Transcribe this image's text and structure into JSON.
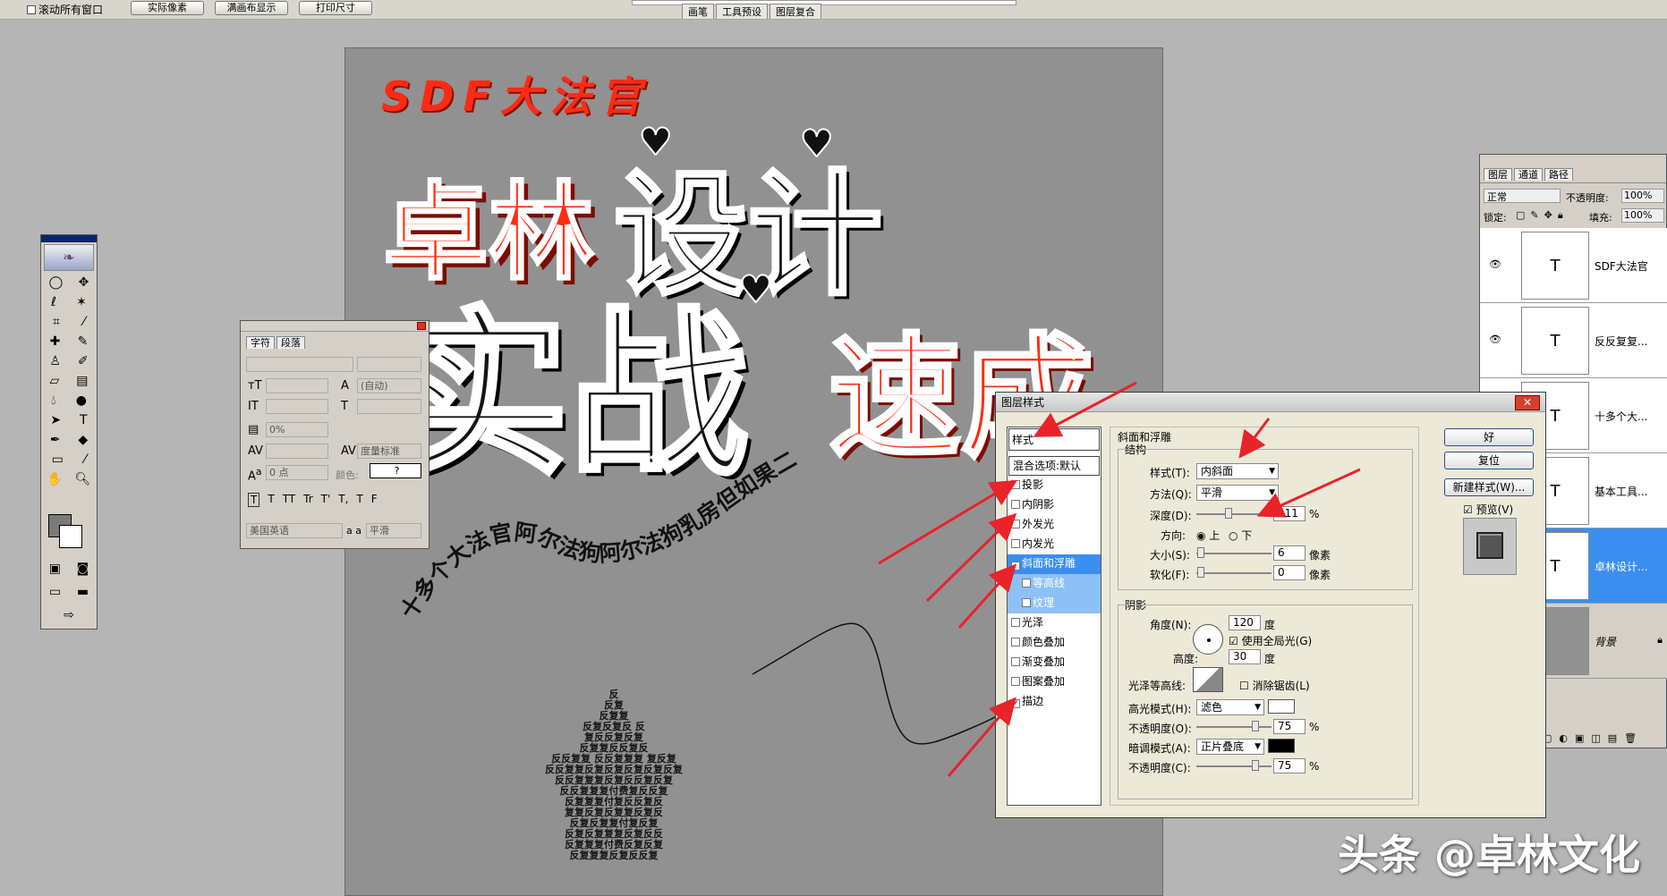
{
  "options_bar": {
    "scroll_all": "滚动所有窗口",
    "actual_pixels": "实际像素",
    "fit_screen": "满画布显示",
    "print_size": "打印尺寸",
    "tabs": [
      "画笔",
      "工具预设",
      "图层复合"
    ]
  },
  "canvas": {
    "sdf": "SDF大法官",
    "zhuolin": "卓林",
    "sheji": "设计",
    "shizhan": "实战",
    "sucheng": "速成",
    "curve_text": "十多个大法官阿尔法狗阿尔法狗乳房但如果二",
    "pyramid_rows": [
      "反",
      "反复",
      "反复复",
      "反复反复反 反",
      "复反反复反复",
      "反复复反反复反",
      "反反复复 反反复复复 复反复",
      "反反复复反复反复反复反复反复",
      "反反复复复反复反反复反复",
      "反反复复复付费复反反复",
      "反复复复付复反反复反",
      "复复反复反复复反复反",
      "反复反复复付复反复",
      "反复反复复复反复反反",
      "反复复复付费反复反复",
      "反复复复反复反反复"
    ]
  },
  "character_panel": {
    "tabs": [
      "字符",
      "段落"
    ],
    "leading": "(自动)",
    "tracking": "0%",
    "kerning_type": "度量标准",
    "baseline": "0 点",
    "color_label": "颜色:",
    "color_value": "?",
    "language": "美国英语",
    "aa_label": "a a",
    "antialias": "平滑",
    "style_buttons": [
      "T",
      "T",
      "TT",
      "Tr",
      "T'",
      "T,",
      "T",
      "F"
    ]
  },
  "layer_style": {
    "title": "图层样式",
    "close": "✕",
    "left_header": "样式",
    "blend_default": "混合选项:默认",
    "items": [
      {
        "label": "投影",
        "checked": false
      },
      {
        "label": "内阴影",
        "checked": false
      },
      {
        "label": "外发光",
        "checked": false
      },
      {
        "label": "内发光",
        "checked": false
      },
      {
        "label": "斜面和浮雕",
        "checked": true
      },
      {
        "label": "等高线",
        "checked": false
      },
      {
        "label": "纹理",
        "checked": false
      },
      {
        "label": "光泽",
        "checked": false
      },
      {
        "label": "颜色叠加",
        "checked": false
      },
      {
        "label": "渐变叠加",
        "checked": false
      },
      {
        "label": "图案叠加",
        "checked": false
      },
      {
        "label": "描边",
        "checked": true
      }
    ],
    "section_bevel": "斜面和浮雕",
    "structure": "结构",
    "style_label": "样式(T):",
    "style_value": "内斜面",
    "method_label": "方法(Q):",
    "method_value": "平滑",
    "depth_label": "深度(D):",
    "depth_value": "411",
    "percent": "%",
    "direction_label": "方向:",
    "dir_up": "上",
    "dir_down": "下",
    "size_label": "大小(S):",
    "size_value": "6",
    "px": "像素",
    "soften_label": "软化(F):",
    "soften_value": "0",
    "shading": "阴影",
    "angle_label": "角度(N):",
    "angle_value": "120",
    "degree": "度",
    "global_light": "使用全局光(G)",
    "altitude_label": "高度:",
    "altitude_value": "30",
    "gloss_label": "光泽等高线:",
    "antialias_label": "消除锯齿(L)",
    "highlight_label": "高光模式(H):",
    "highlight_value": "滤色",
    "opacity1_label": "不透明度(O):",
    "opacity1_value": "75",
    "shadow_label": "暗调模式(A):",
    "shadow_value": "正片叠底",
    "opacity2_label": "不透明度(C):",
    "opacity2_value": "75",
    "ok": "好",
    "reset": "复位",
    "new_style": "新建样式(W)...",
    "preview": "预览(V)"
  },
  "layers_panel": {
    "tabs": [
      "图层",
      "通道",
      "路径"
    ],
    "blend": "正常",
    "opacity_label": "不透明度:",
    "opacity_value": "100%",
    "lock_label": "锁定:",
    "fill_label": "填充:",
    "fill_value": "100%",
    "layers": [
      {
        "name": "SDF大法官",
        "thumb": "T"
      },
      {
        "name": "反反复复...",
        "thumb": "T"
      },
      {
        "name": "十多个大...",
        "thumb": "T"
      },
      {
        "name": "基本工具...",
        "thumb": "T"
      },
      {
        "name": "卓林设计...",
        "thumb": "T"
      },
      {
        "name": "背景",
        "thumb": ""
      }
    ]
  },
  "watermark": "头条 @卓林文化",
  "colors": {
    "accent_red": "#ff2a10",
    "selection_blue": "#3a8ef0",
    "arrow": "#e8232a"
  }
}
